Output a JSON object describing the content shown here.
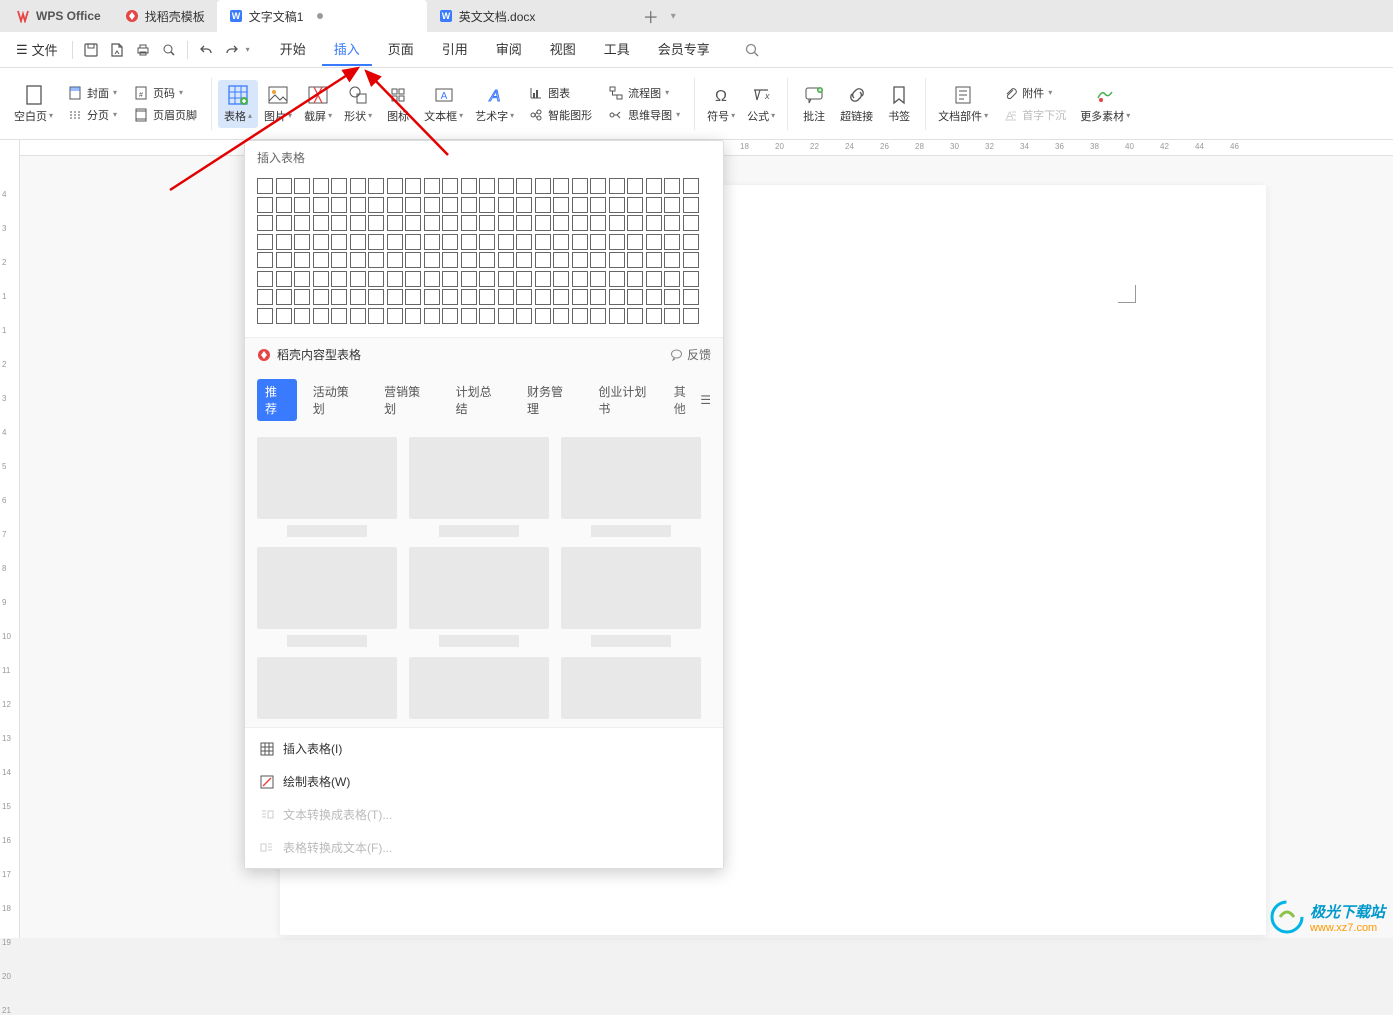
{
  "app": {
    "brand": "WPS Office"
  },
  "tabs": [
    {
      "label": "找稻壳模板",
      "icon": "docer"
    },
    {
      "label": "文字文稿1",
      "icon": "word",
      "active": true,
      "modified": true
    },
    {
      "label": "英文文档.docx",
      "icon": "word"
    }
  ],
  "menubar": {
    "file_label": "文件",
    "tabs": [
      "开始",
      "插入",
      "页面",
      "引用",
      "审阅",
      "视图",
      "工具",
      "会员专享"
    ],
    "active_index": 1
  },
  "ribbon": {
    "g1": {
      "blank_page": "空白页",
      "cover": "封面",
      "page_num": "页码",
      "section": "分页",
      "header_footer": "页眉页脚"
    },
    "g2": {
      "table": "表格",
      "picture": "图片",
      "screenshot": "截屏",
      "shapes": "形状",
      "icons": "图标",
      "textbox": "文本框",
      "wordart": "艺术字",
      "chart": "图表",
      "flowchart": "流程图",
      "smartart": "智能图形",
      "mindmap": "思维导图"
    },
    "g3": {
      "symbol": "符号",
      "equation": "公式"
    },
    "g4": {
      "comment": "批注",
      "hyperlink": "超链接",
      "bookmark": "书签"
    },
    "g5": {
      "doc_parts": "文档部件",
      "attachment": "附件",
      "dropcap": "首字下沉",
      "more_materials": "更多素材"
    }
  },
  "dropdown": {
    "title": "插入表格",
    "section_label": "稻壳内容型表格",
    "feedback": "反馈",
    "tabs": [
      "推荐",
      "活动策划",
      "营销策划",
      "计划总结",
      "财务管理",
      "创业计划书"
    ],
    "tabs_other": "其他",
    "actions": {
      "insert_table": "插入表格(I)",
      "draw_table": "绘制表格(W)",
      "text_to_table": "文本转换成表格(T)...",
      "table_to_text": "表格转换成文本(F)..."
    }
  },
  "ruler": {
    "h": [
      "18",
      "20",
      "22",
      "24",
      "26",
      "28",
      "30",
      "32",
      "34",
      "36",
      "38",
      "40",
      "42",
      "44",
      "46"
    ],
    "v": [
      "4",
      "3",
      "2",
      "1",
      "1",
      "2",
      "3",
      "4",
      "5",
      "6",
      "7",
      "8",
      "9",
      "10",
      "11",
      "12",
      "13",
      "14",
      "15",
      "16",
      "17",
      "18",
      "19",
      "20",
      "21"
    ]
  },
  "watermark": {
    "title": "极光下载站",
    "url": "www.xz7.com"
  }
}
